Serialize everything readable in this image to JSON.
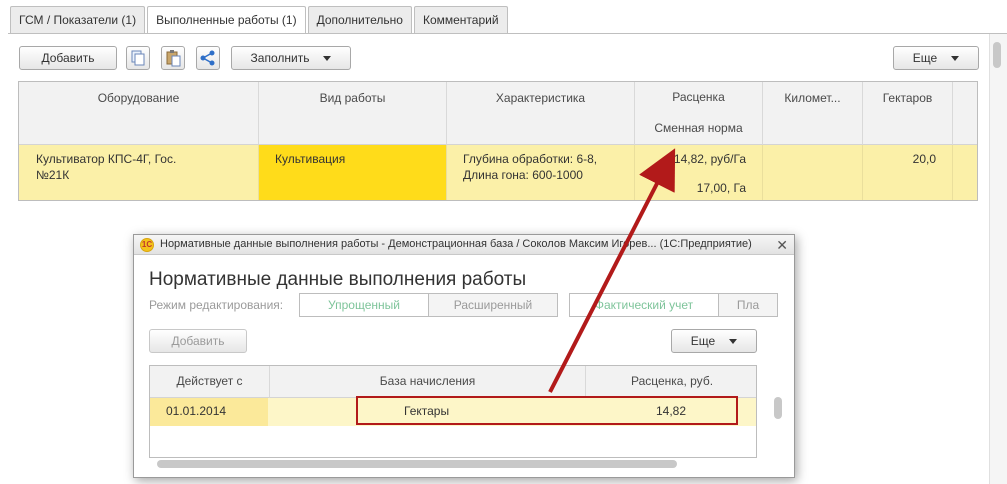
{
  "tabs": [
    {
      "label": "ГСМ / Показатели (1)",
      "active": false
    },
    {
      "label": "Выполненные работы (1)",
      "active": true
    },
    {
      "label": "Дополнительно",
      "active": false
    },
    {
      "label": "Комментарий",
      "active": false
    }
  ],
  "toolbar": {
    "add_label": "Добавить",
    "fill_label": "Заполнить",
    "more_label": "Еще",
    "icons": [
      "copy-icon",
      "paste-icon",
      "share-icon"
    ]
  },
  "grid": {
    "columns": {
      "equipment": "Оборудование",
      "work_type": "Вид работы",
      "characteristic": "Характеристика",
      "rate": "Расценка",
      "shift_norm": "Сменная норма",
      "kilometers": "Километ...",
      "hectares": "Гектаров"
    },
    "row": {
      "equipment": "Культиватор КПС-4Г, Гос.№21К",
      "work_type": "Культивация",
      "characteristic": "Глубина обработки: 6-8, Длина гона: 600-1000",
      "rate": "14,82, руб/Га",
      "shift_norm": "17,00, Га",
      "kilometers": "",
      "hectares": "20,0"
    }
  },
  "modal": {
    "window_title": "Нормативные данные выполнения работы - Демонстрационная база / Соколов Максим Игорев... (1С:Предприятие)",
    "heading": "Нормативные данные выполнения работы",
    "edit_mode_label": "Режим редактирования:",
    "mode_simple": "Упрощенный",
    "mode_extended": "Расширенный",
    "accounting_actual": "Фактический учет",
    "accounting_plan": "Пла",
    "add_label": "Добавить",
    "more_label": "Еще",
    "columns": {
      "valid_from": "Действует с",
      "base": "База начисления",
      "rate": "Расценка, руб."
    },
    "row": {
      "valid_from": "01.01.2014",
      "base": "Гектары",
      "rate": "14,82"
    }
  },
  "colors": {
    "row_highlight": "#fbf0a8",
    "active_cell": "#ffdc1a",
    "arrow": "#b21a1a",
    "modal_row": "#fdf6c8"
  }
}
